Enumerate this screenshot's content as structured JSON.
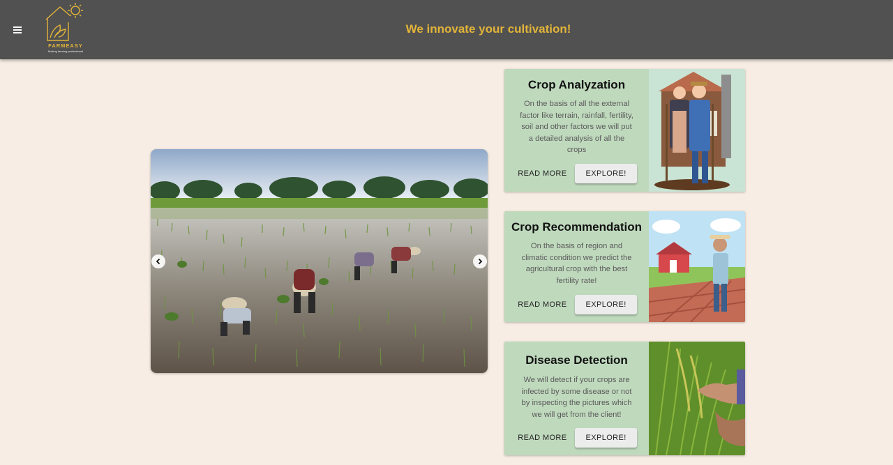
{
  "header": {
    "tagline": "We innovate your cultivation!",
    "logo_name": "FARMEASY",
    "logo_tagline": "Making farming professional",
    "menu_icon": "menu-icon",
    "accent_color": "#e3b43a",
    "bar_color": "#515151"
  },
  "carousel": {
    "prev_icon": "chevron-left-icon",
    "next_icon": "chevron-right-icon"
  },
  "cards": [
    {
      "title": "Crop Analyzation",
      "description": "On the basis of all the external factor like terrain, rainfall, fertility, soil and other factors we will put a detailed analysis of all the crops",
      "read_more": "READ MORE",
      "explore": "EXPLORE!"
    },
    {
      "title": "Crop Recommendation",
      "description": "On the basis of region and climatic condition we predict the agricultural crop with the best fertility rate!",
      "read_more": "READ MORE",
      "explore": "EXPLORE!"
    },
    {
      "title": "Disease Detection",
      "description": "We will detect if your crops are infected by some disease or not by inspecting the pictures which we will get from the client!",
      "read_more": "READ MORE",
      "explore": "EXPLORE!"
    }
  ],
  "colors": {
    "page_bg": "#f7ede4",
    "card_bg": "#bfd9bd"
  }
}
